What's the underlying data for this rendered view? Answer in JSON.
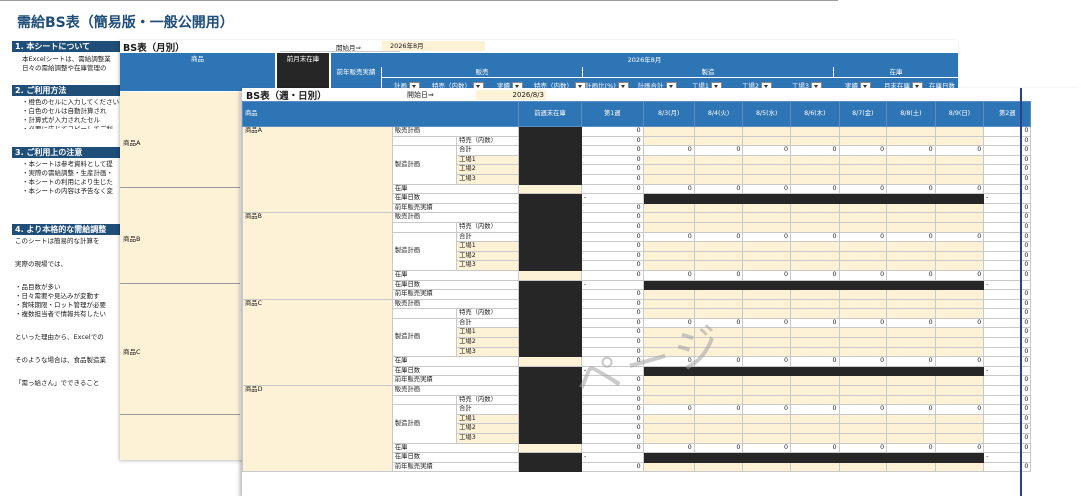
{
  "page_title": "需給BS表（簡易版・一般公開用）",
  "guide": {
    "sections": [
      {
        "heading": "1. 本シートについて",
        "lines": [
          "本Excelシートは、需給調整業",
          "日々の需給調整や在庫管理の"
        ]
      },
      {
        "heading": "2. ご利用方法",
        "lines": [
          "・橙色のセルに入力してください",
          "・白色のセルは自動計算され",
          "・計算式が入力されたセル",
          "・必要に応じてコピーしてご利"
        ]
      },
      {
        "heading": "3. ご利用上の注意",
        "lines": [
          "・本シートは参考資料として提",
          "・実際の需給調整・生産計画・",
          "・本シートの利用により生じた",
          "・本シートの内容は予告なく変"
        ]
      },
      {
        "heading": "4. より本格的な需給調整",
        "lines": [
          "このシートは簡易的な計算を",
          "",
          "実際の現場では、",
          "",
          "・品目数が多い",
          "・日々需要や見込みが変動す",
          "・賞味期限・ロット管理が必要",
          "・複数担当者で情報共有したい",
          "",
          "といった理由から、Excelでの",
          "",
          "そのような場合は、食品製造業",
          "",
          "「需っ給さん」でできること"
        ]
      }
    ]
  },
  "monthly": {
    "title": "BS表（月別）",
    "start_label": "開始月⇒",
    "start_value": "2026年8月",
    "col_product": "商品",
    "col_prev_stock": "前月末在庫",
    "col_prev_sales": "前年販売実績",
    "month_label": "2026年8月",
    "group_sales": "販売",
    "group_production": "製造",
    "group_stock": "在庫",
    "sub_headers": [
      "計画",
      "特売（内数）",
      "実績",
      "特売（内数）",
      "計画比(%)",
      "計画合計",
      "工場1",
      "工場2",
      "工場3",
      "実績",
      "月末在庫",
      "在庫日数"
    ],
    "products": [
      "商品A",
      "商品B",
      "商品C"
    ]
  },
  "weekly": {
    "title": "BS表（週・日別）",
    "start_label": "開始日⇒",
    "start_value": "2026/8/3",
    "headers": {
      "product": "商品",
      "prev_week_stock": "前週末在庫",
      "week1": "第1週",
      "days": [
        "8/3(月)",
        "8/4(火)",
        "8/5(水)",
        "8/6(木)",
        "8/7(金)",
        "8/8(土)",
        "8/9(日)"
      ],
      "week2": "第2週"
    },
    "row_labels": {
      "sales_plan": "販売計画",
      "special": "特売（内数）",
      "production_plan": "製造計画",
      "total": "合計",
      "factory1": "工場1",
      "factory2": "工場2",
      "factory3": "工場3",
      "stock": "在庫",
      "stock_days": "在庫日数",
      "prev_year_sales": "前年販売実績"
    },
    "products": [
      "商品A",
      "商品B",
      "商品C",
      "商品D"
    ],
    "zero": "0",
    "dash": "-"
  },
  "watermark": "ページ",
  "colors": {
    "header_blue": "#2e75b6",
    "title_blue": "#1f4e79",
    "input_cream": "#fdf1d6",
    "dark_cell": "#262626"
  }
}
